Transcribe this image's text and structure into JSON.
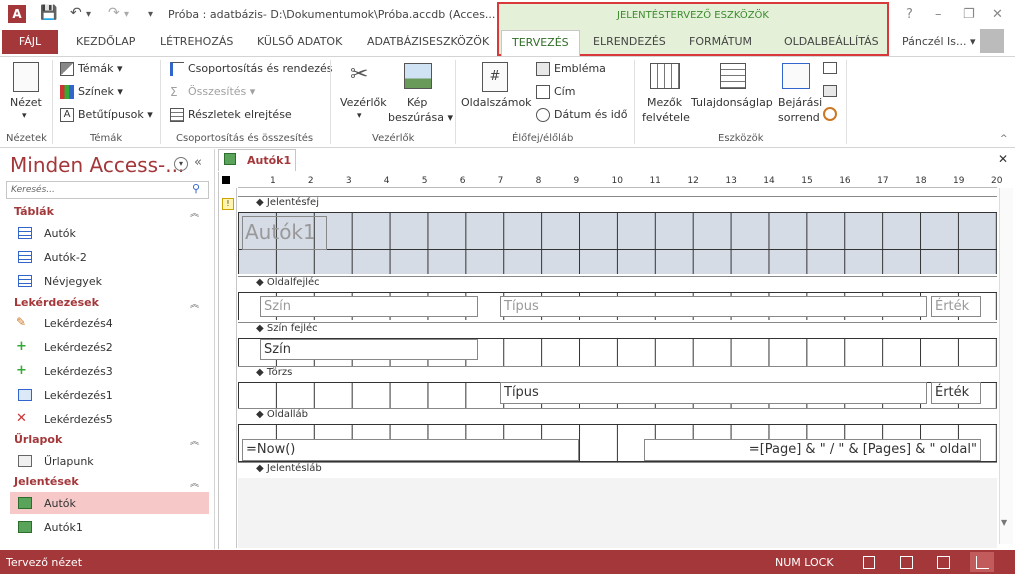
{
  "window": {
    "title": "Próba : adatbázis- D:\\Dokumentumok\\Próba.accdb (Acces...",
    "app_icon_letter": "A",
    "context_label": "JELENTÉSTERVEZŐ ESZKÖZÖK",
    "controls": [
      "?",
      "–",
      "❐",
      "✕"
    ]
  },
  "qat": {
    "save_icon": "save-icon",
    "undo_icon": "undo-icon",
    "redo_icon": "redo-icon",
    "customize_icon": "customize-qat-icon"
  },
  "tabs": {
    "file": "FÁJL",
    "kezdolap": "KEZDŐLAP",
    "letrehozas": "LÉTREHOZÁS",
    "kulso": "KÜLSŐ ADATOK",
    "adatbazis": "ADATBÁZISESZKÖZÖK",
    "tervezes": "TERVEZÉS",
    "elrendezes": "ELRENDEZÉS",
    "formatum": "FORMÁTUM",
    "oldalbeallitas": "OLDALBEÁLLÍTÁS"
  },
  "user": {
    "name": "Pánczél Is...",
    "dropdown": "▾"
  },
  "ribbon": {
    "nezet": "Nézet",
    "temak": "Témák",
    "szinek": "Színek",
    "betutipusok": "Betűtípusok",
    "csoportositas": "Csoportosítás és rendezés",
    "osszesites": "Összesítés",
    "reszletek": "Részletek elrejtése",
    "vezerlok": "Vezérlők",
    "kep": "Kép",
    "beszurasa": "beszúrása",
    "oldalszamok": "Oldalszámok",
    "emblema": "Embléma",
    "cim": "Cím",
    "datum": "Dátum és idő",
    "mezok1": "Mezők",
    "mezok2": "felvétele",
    "tulajdonsaglap": "Tulajdonságlap",
    "bejarasi1": "Bejárási",
    "bejarasi2": "sorrend",
    "groups": {
      "nezetek": "Nézetek",
      "temak": "Témák",
      "csoportositas": "Csoportosítás és összesítés",
      "vezerlok": "Vezérlők",
      "elofej": "Élőfej/élőláb",
      "eszkozok": "Eszközök"
    }
  },
  "nav": {
    "title": "Minden Access-...",
    "search_placeholder": "Keresés...",
    "sections": {
      "tablak": "Táblák",
      "lekerdezesek": "Lekérdezések",
      "urlapok": "Űrlapok",
      "jelentesek": "Jelentések"
    },
    "items": {
      "t1": "Autók",
      "t2": "Autók-2",
      "t3": "Névjegyek",
      "q4": "Lekérdezés4",
      "q2": "Lekérdezés2",
      "q3": "Lekérdezés3",
      "q1": "Lekérdezés1",
      "q5": "Lekérdezés5",
      "f1": "Űrlapunk",
      "r1": "Autók",
      "r2": "Autók1"
    }
  },
  "document": {
    "tab": "Autók1",
    "close": "✕",
    "ruler_labels": [
      "1",
      "2",
      "3",
      "4",
      "5",
      "6",
      "7",
      "8",
      "9",
      "10",
      "11",
      "12",
      "13",
      "14",
      "15",
      "16",
      "17",
      "18",
      "19",
      "20"
    ],
    "sections": {
      "jelentesfej": "Jelentésfej",
      "oldalfejlec": "Oldalfejléc",
      "szinfejlec": "Szín fejléc",
      "torzs": "Törzs",
      "oldallab": "Oldalláb",
      "jelenteslab": "Jelentésláb"
    },
    "controls": {
      "title": "Autók1",
      "szin_lbl": "Szín",
      "tipus_lbl": "Típus",
      "ertek_lbl": "Érték",
      "szin_field": "Szín",
      "tipus_field": "Típus",
      "ertek_field": "Érték",
      "now": "=Now()",
      "page": "=[Page] & \" / \" & [Pages] & \" oldal\""
    }
  },
  "status": {
    "text": "Tervező nézet",
    "numlock": "NUM LOCK"
  }
}
